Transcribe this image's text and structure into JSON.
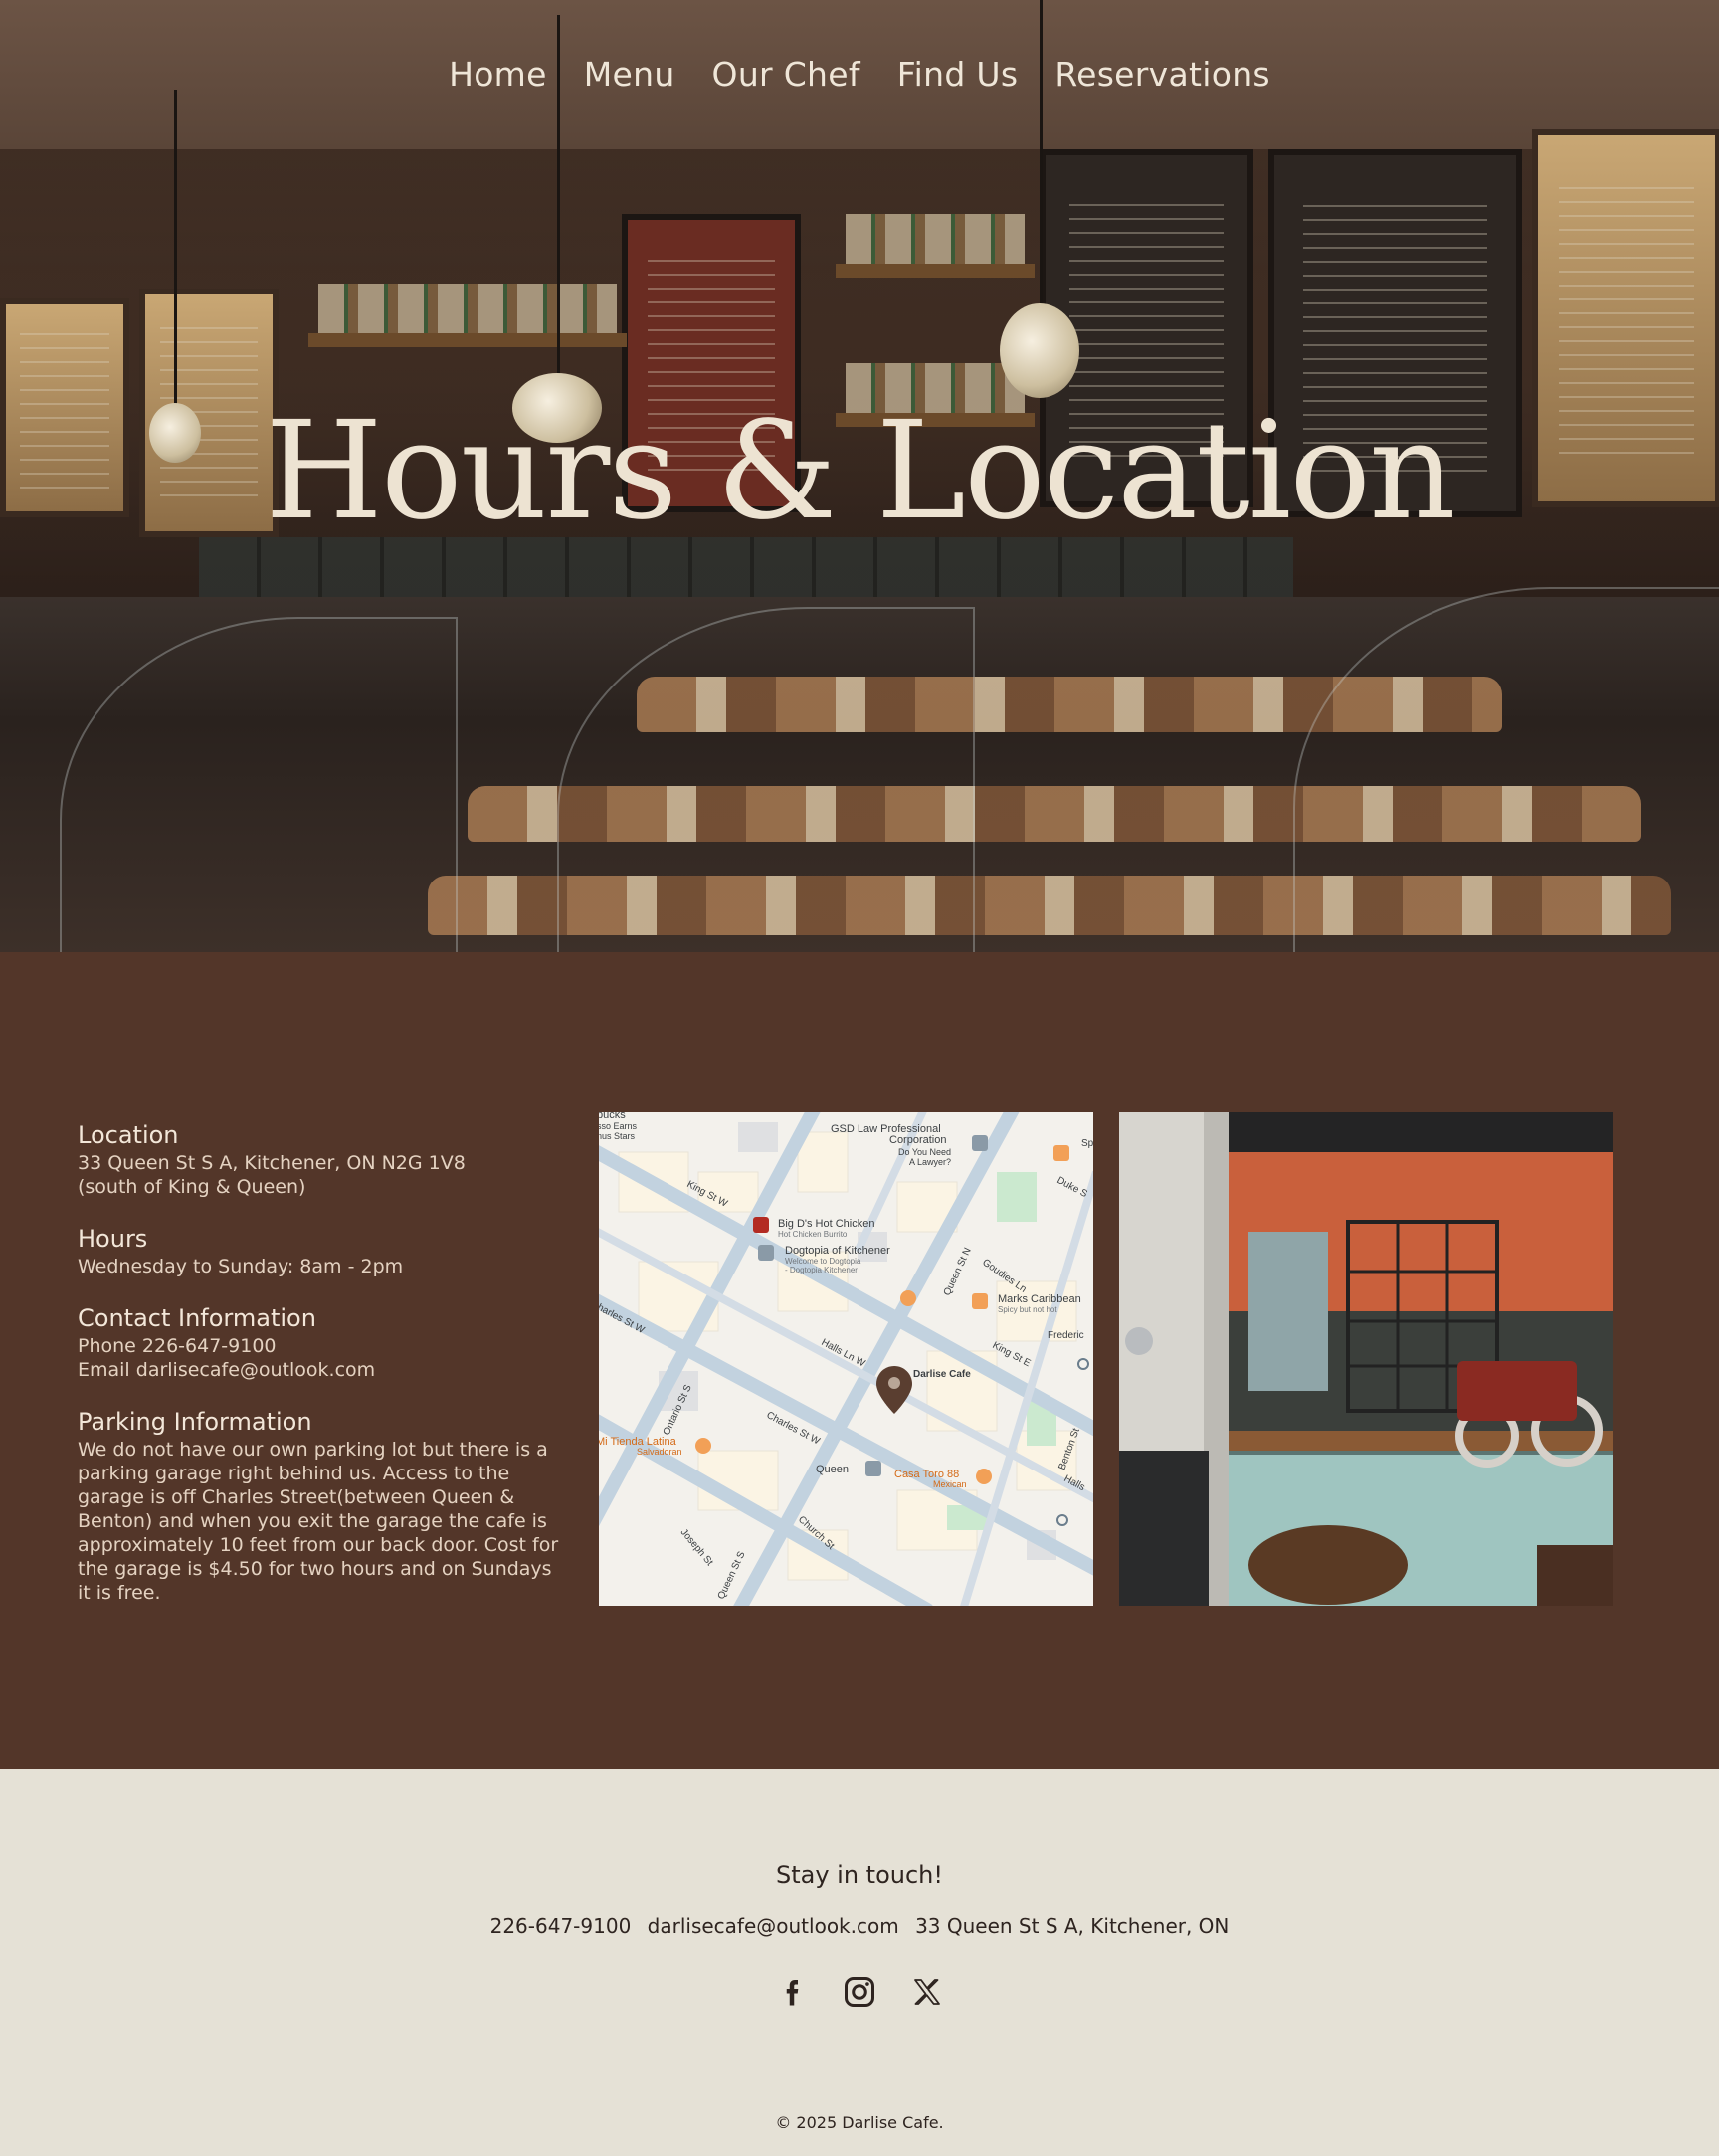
{
  "nav": {
    "items": [
      "Home",
      "Menu",
      "Our Chef",
      "Find Us",
      "Reservations"
    ]
  },
  "hero": {
    "title": "Hours & Location"
  },
  "location": {
    "heading": "Location",
    "address": "33 Queen St S A, Kitchener, ON N2G 1V8",
    "note": "(south of King & Queen)"
  },
  "hours": {
    "heading": "Hours",
    "text": "Wednesday to Sunday: 8am - 2pm"
  },
  "contact": {
    "heading": "Contact Information",
    "phone": "Phone 226-647-9100",
    "email": "Email  darlisecafe@outlook.com"
  },
  "parking": {
    "heading": "Parking Information",
    "text": "We do not have our own parking lot but there is a parking garage right behind us. Access to the garage is off Charles Street(between Queen & Benton) and when you exit the garage the cafe is approximately 10 feet from our back door. Cost for the garage is $4.50 for two hours and on Sundays it is free."
  },
  "map": {
    "pin_label": "Darlise Cafe",
    "labels": {
      "gsd": "GSD Law Professional",
      "gsd2": "Corporation",
      "gsd3": "Do You Need",
      "gsd4": "A Lawyer?",
      "bigd": "Big D's Hot Chicken",
      "bigd2": "Hot Chicken Burrito",
      "dogtopia": "Dogtopia of Kitchener",
      "dogtopia2": "Welcome to Dogtopia",
      "dogtopia3": "- Dogtopia Kitchener",
      "marks": "Marks Caribbean",
      "marks2": "Spicy but not hot",
      "casa": "Casa Toro 88",
      "casa2": "Mexican",
      "tienda": "Mi Tienda Latina",
      "tienda2": "Salvadoran",
      "queen": "Queen",
      "king": "King St W",
      "kinge": "King St E",
      "charles": "Charles St W",
      "charles2": "harles St W",
      "halls": "Halls Ln W",
      "halls2": "Halls",
      "ontario": "Ontario St S",
      "church": "Church St",
      "joseph": "Joseph St",
      "queens": "Queen St S",
      "queenn": "Queen St N",
      "goudies": "Goudies Ln",
      "duke": "Duke S",
      "benton": "Benton St",
      "frederick": "Frederic",
      "bucks": "bucks",
      "bucks2": "sso Earns",
      "bucks3": "nus Stars",
      "sp": "Sp"
    }
  },
  "footer": {
    "tagline": "Stay in touch!",
    "phone": "226-647-9100",
    "email": "darlisecafe@outlook.com",
    "address": "33 Queen St S A, Kitchener, ON",
    "copyright": "© 2025 Darlise Cafe."
  },
  "colors": {
    "content_bg": "#533629",
    "footer_bg": "#e5e1d6",
    "hero_text": "#ede3d2",
    "map_pin": "#5a3e30"
  },
  "icons": [
    "facebook-icon",
    "instagram-icon",
    "x-twitter-icon"
  ]
}
